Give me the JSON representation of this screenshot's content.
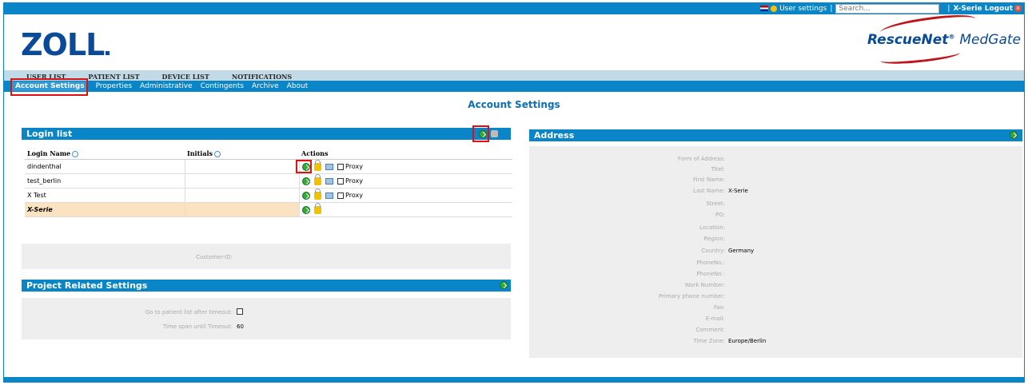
{
  "topbar": {
    "user_settings": "User settings",
    "search_placeholder": "Search...",
    "logout": "X-Serie Logout"
  },
  "logo": {
    "zoll": "ZOLL",
    "rescuenet": "RescueNet",
    "medgate": "MedGate"
  },
  "main_nav": [
    "USER LIST",
    "PATIENT LIST",
    "DEVICE LIST",
    "NOTIFICATIONS"
  ],
  "sub_nav": [
    "Account Settings",
    "Properties",
    "Administrative",
    "Contingents",
    "Archive",
    "About"
  ],
  "page_title": "Account Settings",
  "login_list": {
    "title": "Login list",
    "columns": [
      "Login Name",
      "Initials",
      "Actions"
    ],
    "proxy_label": "Proxy",
    "rows": [
      {
        "name": "dindenthal",
        "initials": "",
        "proxy": true
      },
      {
        "name": "test_berlin",
        "initials": "",
        "proxy": true
      },
      {
        "name": "X Test",
        "initials": "",
        "proxy": true
      },
      {
        "name": "X-Serie",
        "initials": "",
        "proxy": false
      }
    ],
    "customer_id_label": "Customer-ID:",
    "customer_id_value": ""
  },
  "project_settings": {
    "title": "Project Related Settings",
    "timeout_label": "Go to patient list after timeout:",
    "timespan_label": "Time span until Timeout:",
    "timespan_value": "60"
  },
  "address": {
    "title": "Address",
    "fields": [
      {
        "label": "Form of Address:",
        "value": ""
      },
      {
        "label": "Titel:",
        "value": ""
      },
      {
        "label": "First Name:",
        "value": ""
      },
      {
        "label": "Last Name:",
        "value": "X-Serie"
      },
      {
        "label": "Street:",
        "value": ""
      },
      {
        "label": "PO:",
        "value": ""
      },
      {
        "label": "Location:",
        "value": ""
      },
      {
        "label": "Region:",
        "value": ""
      },
      {
        "label": "Country:",
        "value": "Germany"
      },
      {
        "label": "PhoneNo.:",
        "value": ""
      },
      {
        "label": "PhoneNo.:",
        "value": ""
      },
      {
        "label": "Work Number:",
        "value": ""
      },
      {
        "label": "Primary phone number:",
        "value": ""
      },
      {
        "label": "Fax:",
        "value": ""
      },
      {
        "label": "E-mail:",
        "value": ""
      },
      {
        "label": "Comment:",
        "value": ""
      },
      {
        "label": "Time Zone:",
        "value": "Europe/Berlin"
      }
    ]
  },
  "colors": {
    "primary": "#0a86c8",
    "brand": "#0a4a9a",
    "highlight": "#e01010"
  }
}
